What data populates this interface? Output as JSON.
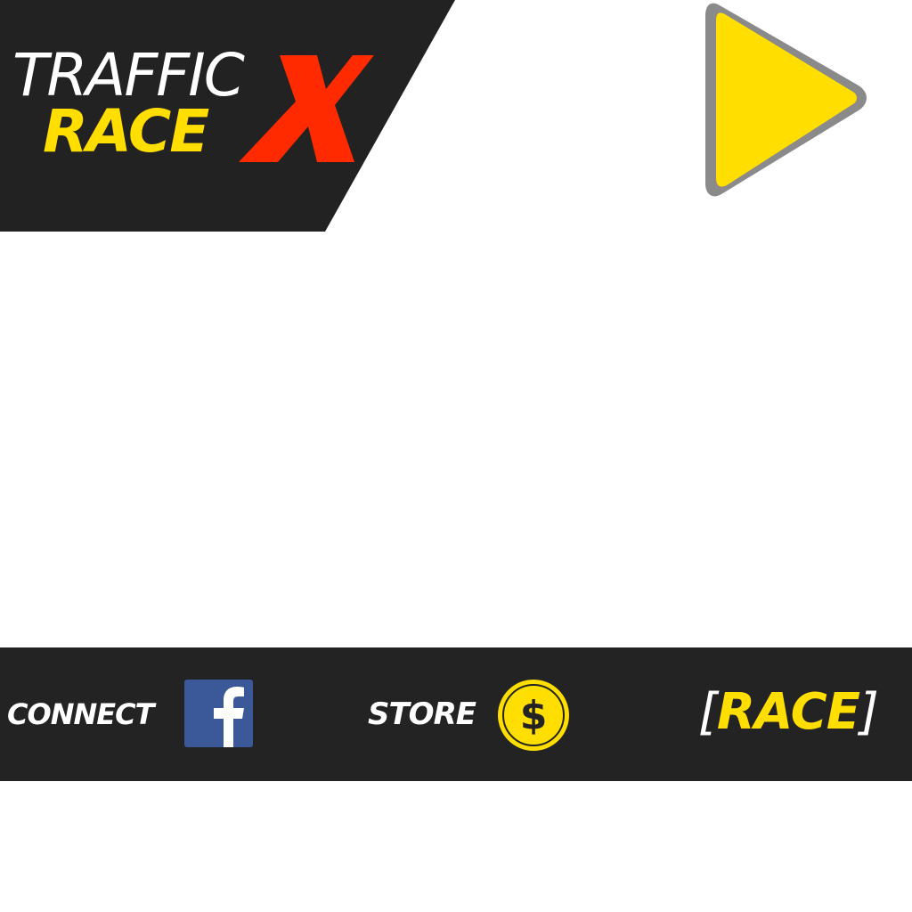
{
  "logo": {
    "line1": "TRAFFIC",
    "line2": "RACE",
    "mark": "X",
    "colors": {
      "banner": "#222222",
      "line1": "#ffffff",
      "line2": "#ffde00",
      "mark": "#ff2a00"
    }
  },
  "play_button": {
    "icon": "play-icon",
    "fill": "#ffde00",
    "stroke": "#8a8a8a"
  },
  "bottom_bar": {
    "background": "#232323",
    "connect": {
      "label": "CONNECT",
      "icon": "facebook-icon",
      "icon_color": "#3b5998"
    },
    "store": {
      "label": "STORE",
      "icon": "coin-dollar-icon",
      "icon_color": "#ffde00"
    },
    "race": {
      "open_bracket": "[",
      "label": "RACE",
      "close_bracket": "]"
    }
  }
}
